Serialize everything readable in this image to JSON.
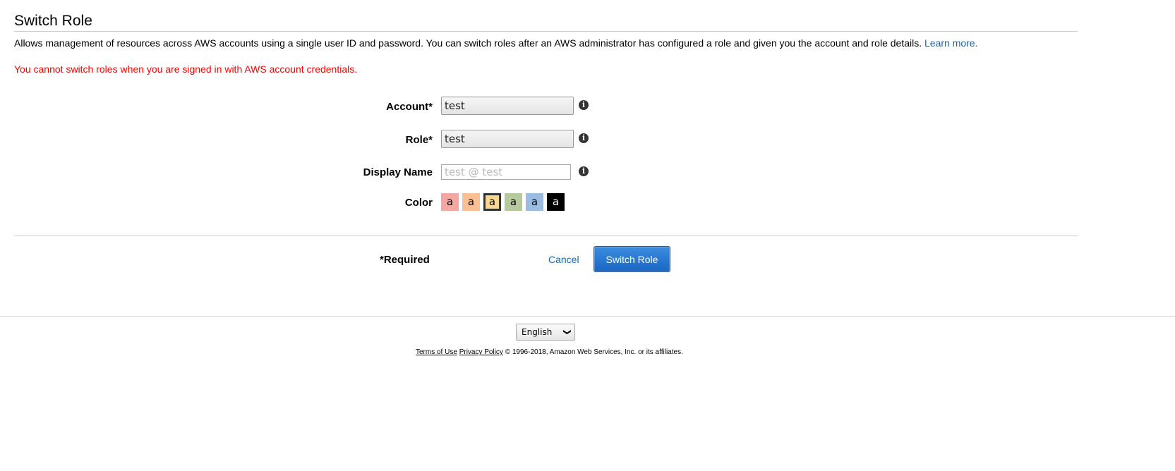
{
  "header": {
    "title": "Switch Role"
  },
  "description": {
    "text": "Allows management of resources across AWS accounts using a single user ID and password. You can switch roles after an AWS administrator has configured a role and given you the account and role details. ",
    "link": "Learn more."
  },
  "error": "You cannot switch roles when you are signed in with AWS account credentials.",
  "form": {
    "account": {
      "label": "Account*",
      "value": "test"
    },
    "role": {
      "label": "Role*",
      "value": "test"
    },
    "display_name": {
      "label": "Display Name",
      "value": "",
      "placeholder": "test @ test"
    },
    "color": {
      "label": "Color",
      "selected_index": 2,
      "swatches": [
        {
          "char": "a",
          "bg": "#f2a7a1",
          "fg": "#000000"
        },
        {
          "char": "a",
          "bg": "#fbbf93",
          "fg": "#000000"
        },
        {
          "char": "a",
          "bg": "#fad791",
          "fg": "#000000"
        },
        {
          "char": "a",
          "bg": "#b7ca9d",
          "fg": "#000000"
        },
        {
          "char": "a",
          "bg": "#99bce3",
          "fg": "#000000"
        },
        {
          "char": "a",
          "bg": "#000000",
          "fg": "#ffffff"
        }
      ]
    },
    "info_icon": "info-icon"
  },
  "actions": {
    "required_note": "*Required",
    "cancel_label": "Cancel",
    "switch_label": "Switch Role"
  },
  "footer": {
    "language": "English",
    "terms": "Terms of Use",
    "privacy": "Privacy Policy",
    "copyright": "© 1996-2018, Amazon Web Services, Inc. or its affiliates."
  }
}
